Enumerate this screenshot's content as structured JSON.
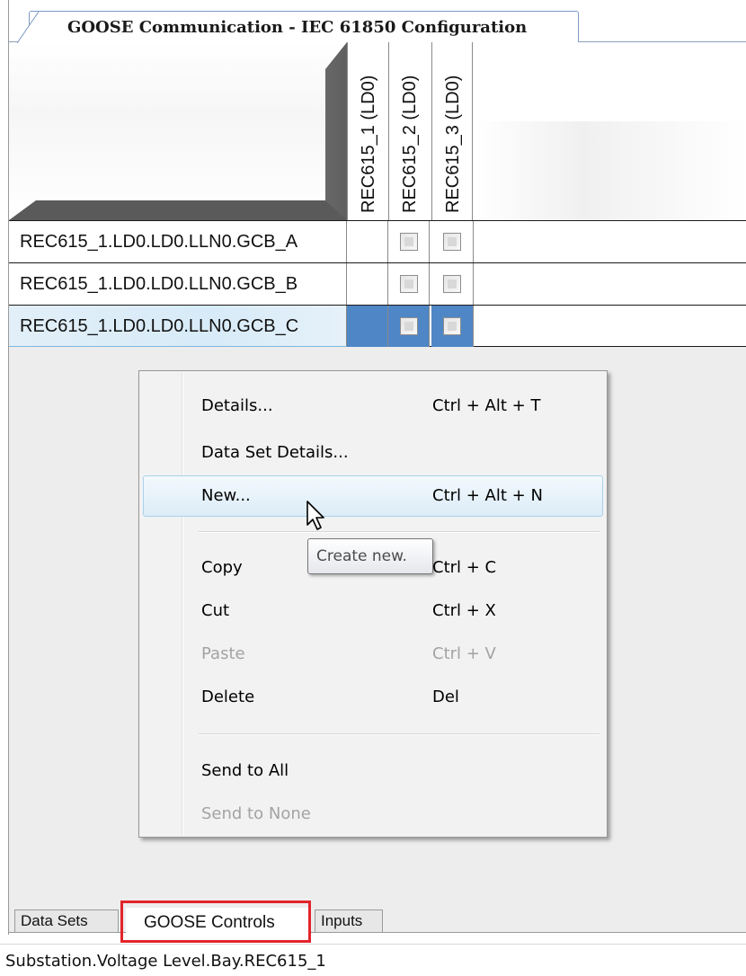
{
  "document_tab": {
    "title": "GOOSE Communication - IEC 61850 Configuration"
  },
  "grid": {
    "columns": [
      "REC615_1 (LD0)",
      "REC615_2 (LD0)",
      "REC615_3 (LD0)"
    ],
    "rows": [
      {
        "label": "REC615_1.LD0.LD0.LLN0.GCB_A",
        "selected": false
      },
      {
        "label": "REC615_1.LD0.LD0.LLN0.GCB_B",
        "selected": false
      },
      {
        "label": "REC615_1.LD0.LD0.LLN0.GCB_C",
        "selected": true
      }
    ]
  },
  "context_menu": {
    "items": [
      {
        "label": "Details...",
        "shortcut": "Ctrl + Alt + T",
        "enabled": true
      },
      {
        "label": "Data Set Details...",
        "shortcut": "",
        "enabled": true
      },
      {
        "label": "New...",
        "shortcut": "Ctrl + Alt + N",
        "enabled": true,
        "hovered": true
      },
      {
        "label": "Copy",
        "shortcut": "Ctrl + C",
        "enabled": true
      },
      {
        "label": "Cut",
        "shortcut": "Ctrl + X",
        "enabled": true
      },
      {
        "label": "Paste",
        "shortcut": "Ctrl + V",
        "enabled": false
      },
      {
        "label": "Delete",
        "shortcut": "Del",
        "enabled": true
      },
      {
        "label": "Send to All",
        "shortcut": "",
        "enabled": true
      },
      {
        "label": "Send to None",
        "shortcut": "",
        "enabled": false
      }
    ]
  },
  "tooltip": {
    "text": "Create new."
  },
  "bottom_tabs": {
    "data_sets": "Data Sets",
    "goose_controls": "GOOSE Controls",
    "inputs": "Inputs"
  },
  "status_bar": {
    "path": "Substation.Voltage Level.Bay.REC615_1"
  },
  "colors": {
    "selection": "#4f86c6",
    "highlight_box": "#e2242b",
    "tab_border": "#7d9ac2"
  },
  "icons": {
    "cursor": "arrow-cursor-icon",
    "checkbox": "checkbox-icon"
  }
}
